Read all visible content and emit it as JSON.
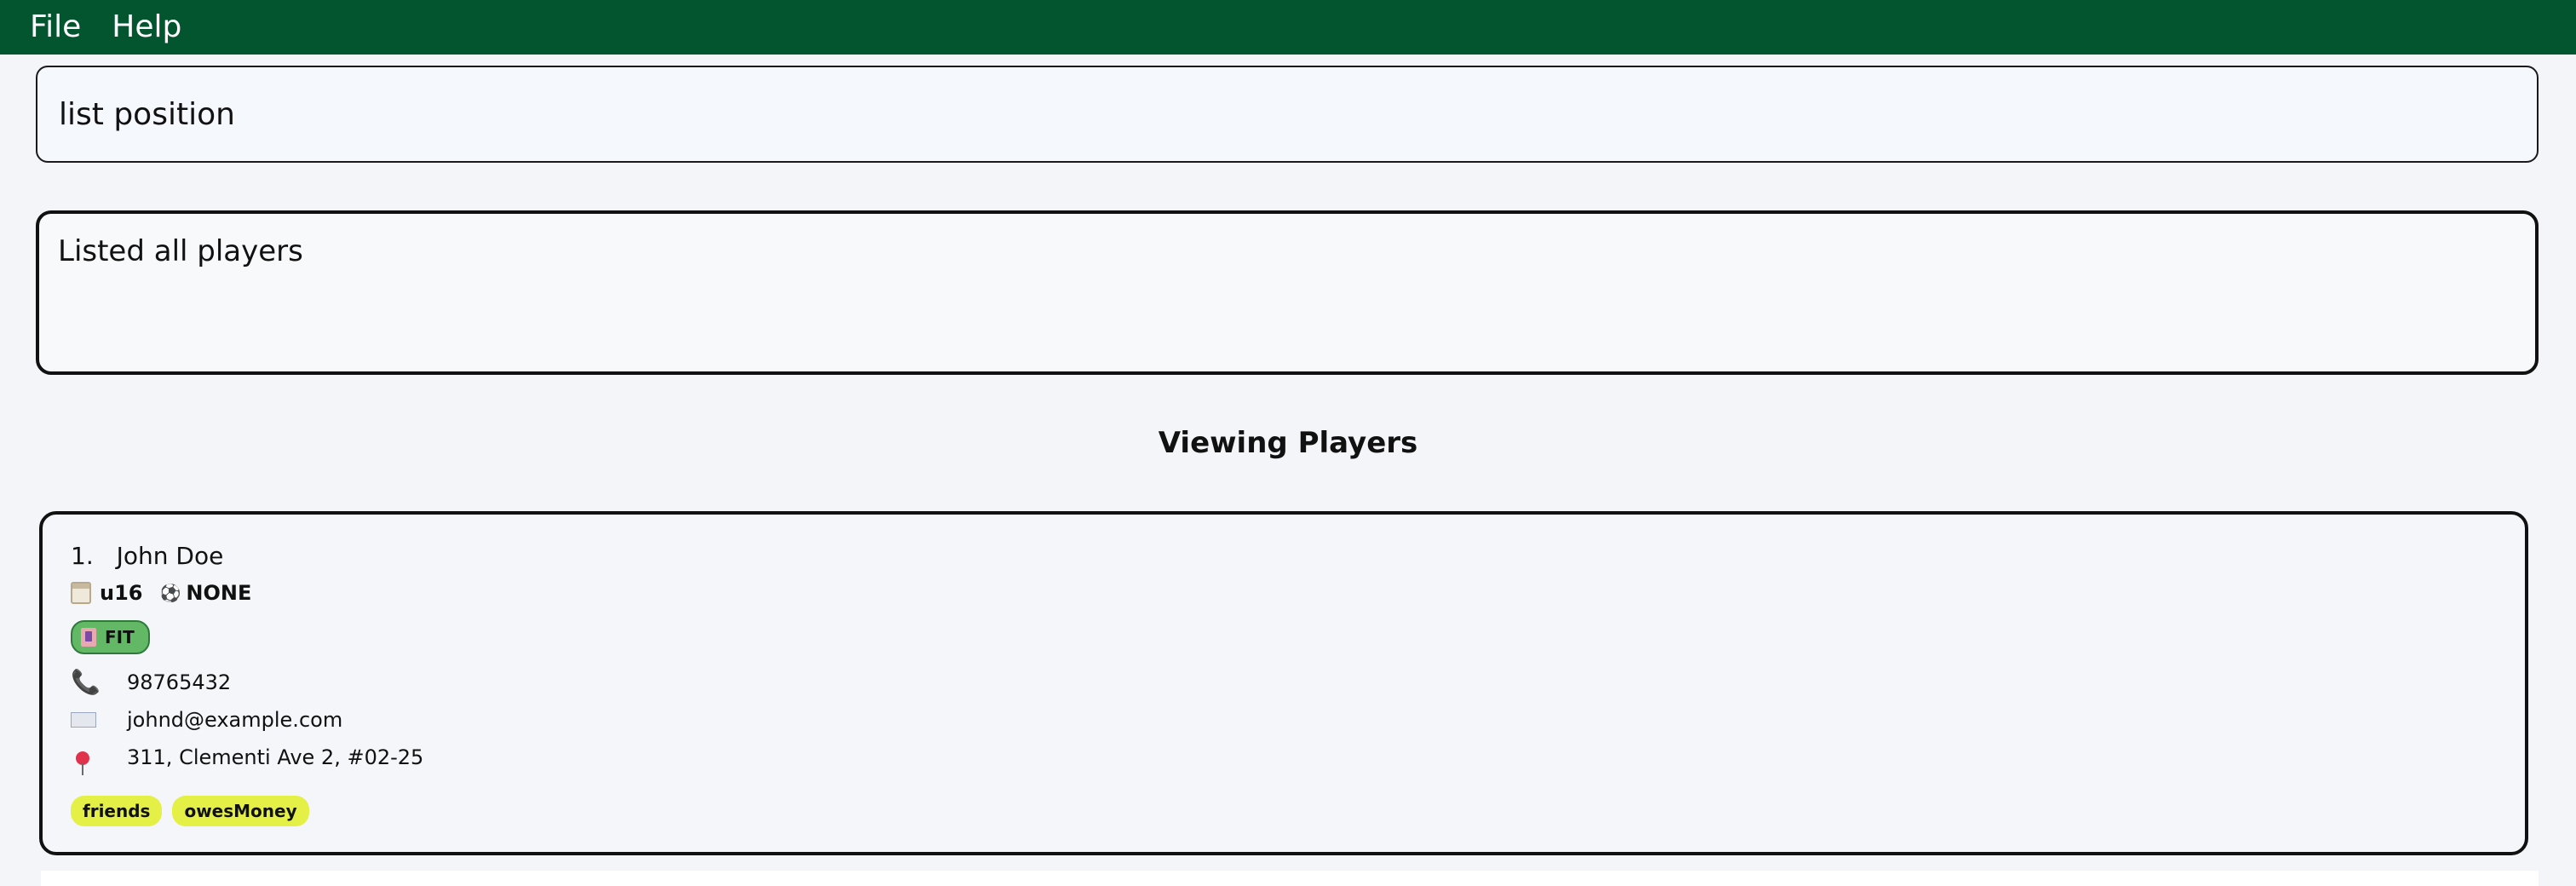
{
  "menubar": {
    "items": [
      {
        "label": "File"
      },
      {
        "label": "Help"
      }
    ]
  },
  "command": {
    "value": "list position",
    "placeholder": ""
  },
  "result": {
    "message": "Listed all players"
  },
  "list": {
    "title": "Viewing Players",
    "players": [
      {
        "index": "1.",
        "name": "John Doe",
        "team": "u16",
        "position": "NONE",
        "status": "FIT",
        "phone": "98765432",
        "email": "johnd@example.com",
        "address": "311, Clementi Ave 2, #02-25",
        "tags": [
          "friends",
          "owesMoney"
        ]
      }
    ]
  },
  "colors": {
    "menubar_bg": "#02552f",
    "fit_pill": "#62b865",
    "tag_bg": "#e4f046"
  }
}
